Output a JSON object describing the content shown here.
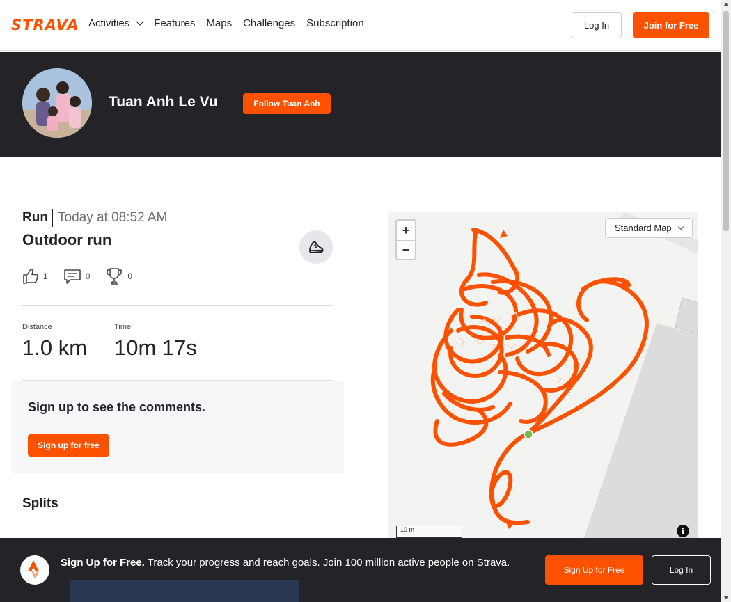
{
  "nav": {
    "logo": "STRAVA",
    "links": [
      "Activities",
      "Features",
      "Maps",
      "Challenges",
      "Subscription"
    ],
    "login_label": "Log In",
    "join_label": "Join for Free"
  },
  "athlete": {
    "name": "Tuan Anh Le Vu",
    "follow_label": "Follow Tuan Anh"
  },
  "activity": {
    "type": "Run",
    "time": "Today at 08:52 AM",
    "title": "Outdoor run",
    "kudos": "1",
    "comments": "0",
    "achievements": "0",
    "stats": [
      {
        "label": "Distance",
        "value": "1.0 km"
      },
      {
        "label": "Time",
        "value": "10m 17s"
      }
    ]
  },
  "comments": {
    "prompt": "Sign up to see the comments.",
    "signup_label": "Sign up for free"
  },
  "splits": {
    "title": "Splits"
  },
  "map": {
    "zoom_in": "+",
    "zoom_out": "−",
    "style_select": "Standard Map",
    "scale_label": "10 m",
    "info_icon": "i",
    "route_color": "#fc5200",
    "start_color": "#7ab648"
  },
  "banner": {
    "headline": "Sign Up for Free.",
    "body": "Track your progress and reach goals. Join 100 million active people on Strava.",
    "signup_label": "Sign Up for Free",
    "login_label": "Log In"
  }
}
